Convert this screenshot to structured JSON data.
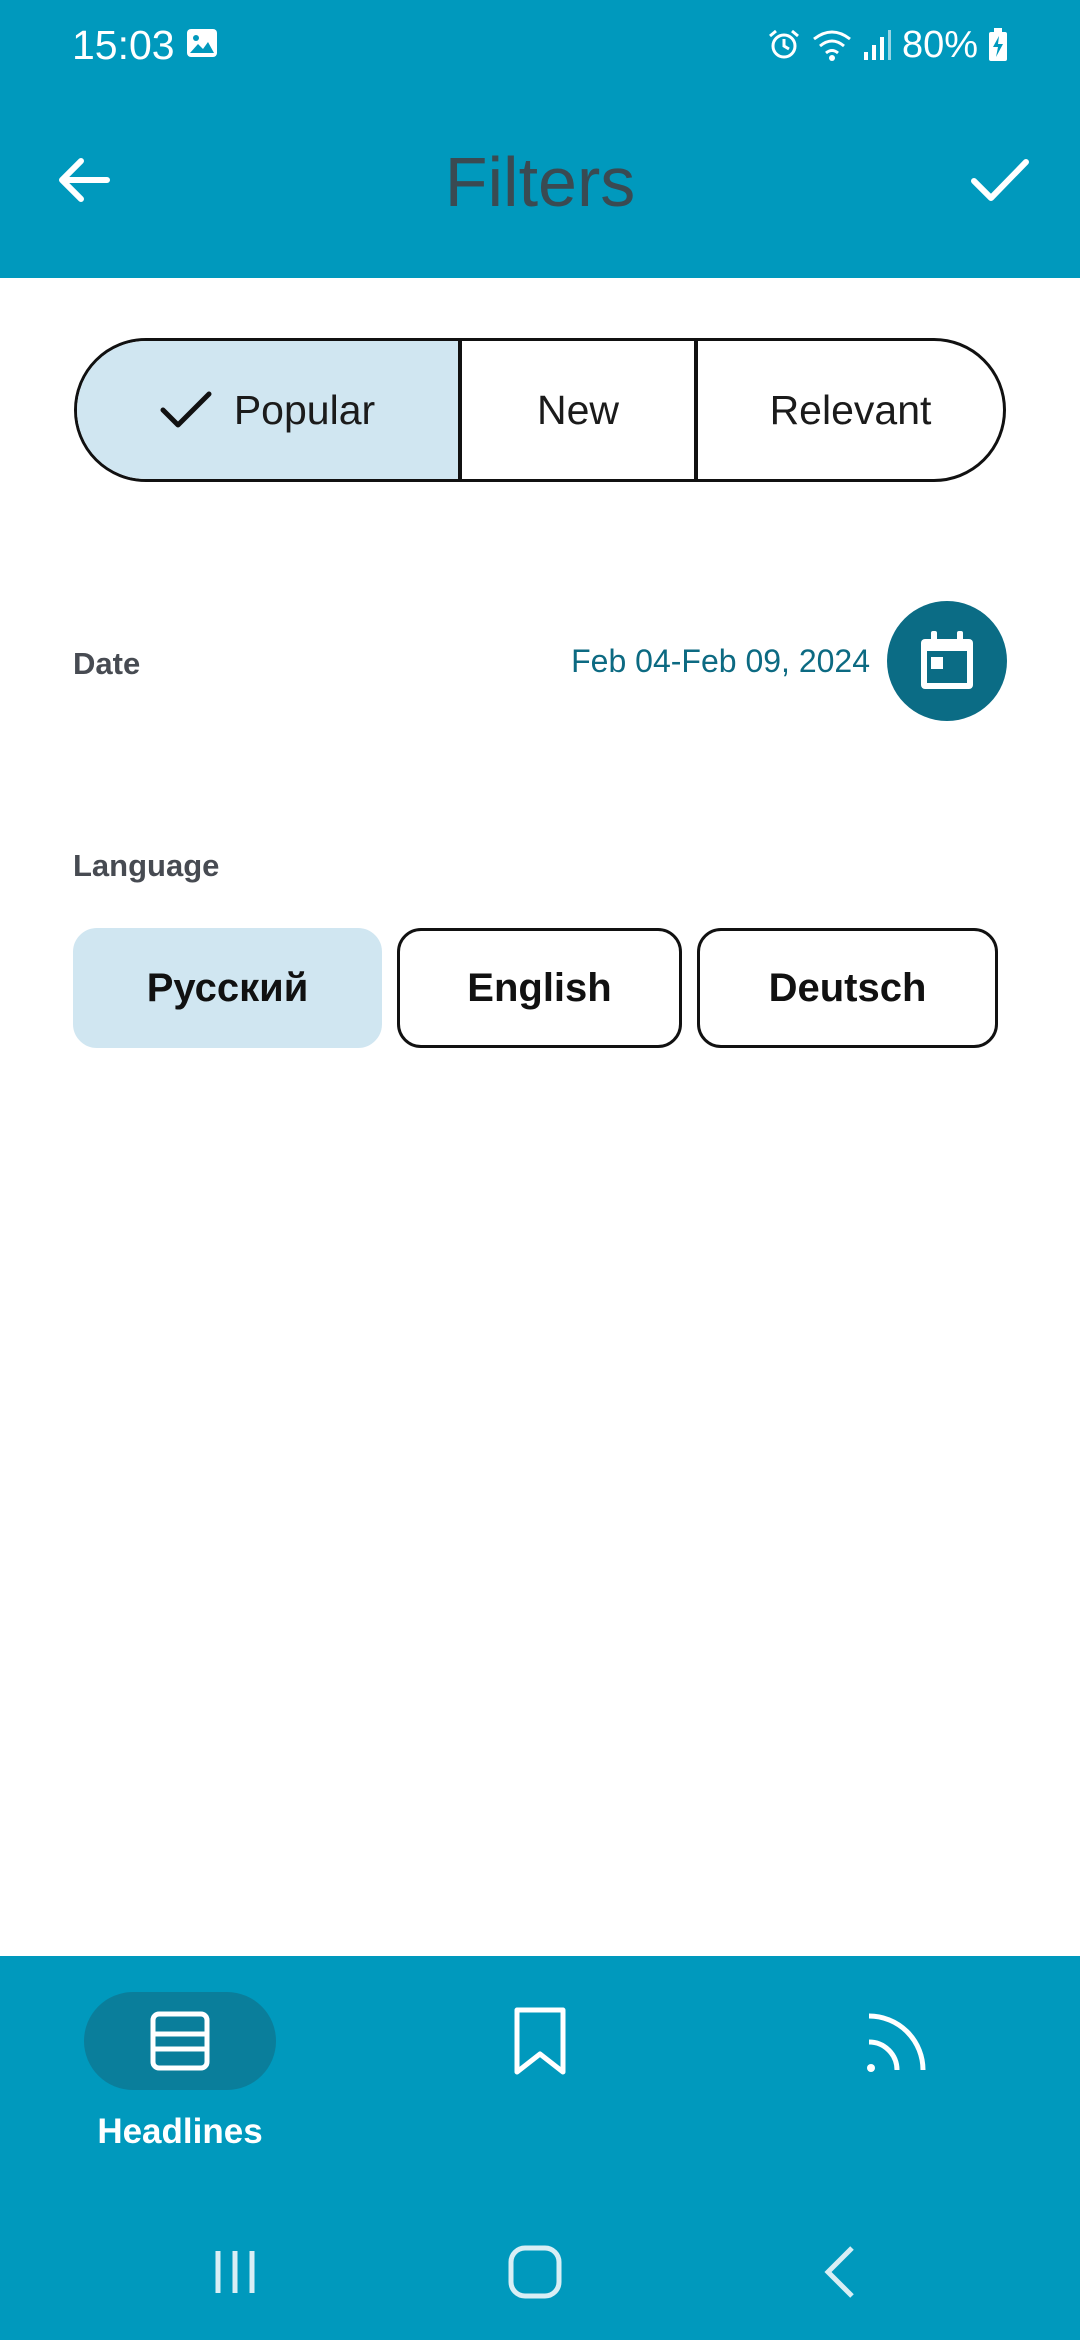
{
  "status_bar": {
    "time": "15:03",
    "battery": "80%",
    "icons": [
      "gallery-icon",
      "alarm-icon",
      "wifi-icon",
      "signal-icon",
      "battery-charging-icon"
    ]
  },
  "app_bar": {
    "title": "Filters",
    "back_icon": "arrow-left-icon",
    "confirm_icon": "check-icon"
  },
  "sort": {
    "options": [
      {
        "label": "Popular",
        "selected": true
      },
      {
        "label": "New",
        "selected": false
      },
      {
        "label": "Relevant",
        "selected": false
      }
    ]
  },
  "date": {
    "label": "Date",
    "value": "Feb 04-Feb 09, 2024",
    "icon": "calendar-icon"
  },
  "language": {
    "label": "Language",
    "options": [
      {
        "label": "Русский",
        "selected": true
      },
      {
        "label": "English",
        "selected": false
      },
      {
        "label": "Deutsch",
        "selected": false
      }
    ]
  },
  "bottom_nav": {
    "items": [
      {
        "label": "Headlines",
        "icon": "headlines-icon",
        "selected": true
      },
      {
        "label": "",
        "icon": "bookmark-icon",
        "selected": false
      },
      {
        "label": "",
        "icon": "feed-icon",
        "selected": false
      }
    ]
  },
  "colors": {
    "primary": "#0099bd",
    "selected_bg": "#d0e6f1",
    "accent_dark": "#0b6c85"
  }
}
